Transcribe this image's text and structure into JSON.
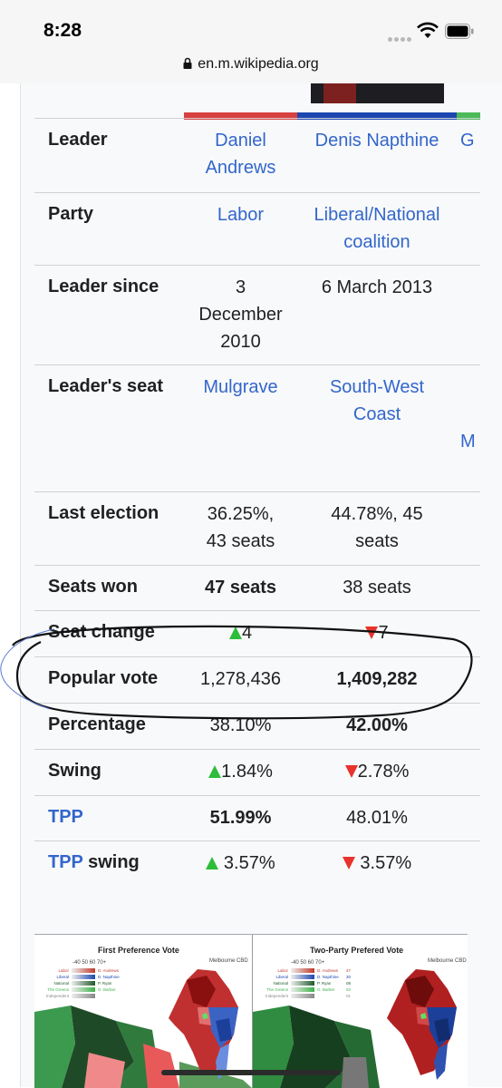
{
  "status": {
    "time": "8:28",
    "url": "en.m.wikipedia.org"
  },
  "colors": {
    "labor": "#d94040",
    "coalition": "#1c47b0",
    "greens": "#4cba59",
    "link": "#3366cc"
  },
  "rows": [
    {
      "label": "Leader",
      "label_link": false,
      "c1": [
        "Daniel",
        "Andrews"
      ],
      "c1_link": true,
      "c2": [
        "Denis Napthine"
      ],
      "c2_link": true,
      "c3": "G",
      "c3_link": true
    },
    {
      "label": "Party",
      "label_link": false,
      "c1": [
        "Labor"
      ],
      "c1_link": true,
      "c2": [
        "Liberal/National",
        "coalition"
      ],
      "c2_link": true
    },
    {
      "label": "Leader since",
      "label_link": false,
      "c1": [
        "3",
        "December",
        "2010"
      ],
      "c2": [
        "6 March 2013"
      ]
    },
    {
      "label": "Leader's seat",
      "label_link": false,
      "c1": [
        "Mulgrave"
      ],
      "c1_link": true,
      "c2": [
        "South-West",
        "Coast"
      ],
      "c2_link": true,
      "c3": "M",
      "c3_link": true
    },
    {
      "label": "Last election",
      "label_link": false,
      "c1": [
        "36.25%,",
        "43 seats"
      ],
      "c2": [
        "44.78%, 45",
        "seats"
      ]
    },
    {
      "label": "Seats won",
      "label_link": false,
      "c1": [
        "47 seats"
      ],
      "c1_bold": true,
      "c2": [
        "38 seats"
      ]
    },
    {
      "label": "Seat change",
      "label_link": false,
      "c1": [
        "4"
      ],
      "c1_arrow": "up",
      "c2": [
        "7"
      ],
      "c2_arrow": "down"
    },
    {
      "label": "Popular vote",
      "label_link": false,
      "c1": [
        "1,278,436"
      ],
      "c2": [
        "1,409,282"
      ],
      "c2_bold": true
    },
    {
      "label": "Percentage",
      "label_link": false,
      "c1": [
        "38.10%"
      ],
      "c2": [
        "42.00%"
      ],
      "c2_bold": true
    },
    {
      "label": "Swing",
      "label_link": false,
      "c1": [
        "1.84%"
      ],
      "c1_arrow": "up",
      "c2": [
        "2.78%"
      ],
      "c2_arrow": "down"
    },
    {
      "label": "TPP",
      "label_link": true,
      "c1": [
        "51.99%"
      ],
      "c1_bold": true,
      "c2": [
        "48.01%"
      ]
    },
    {
      "label": "TPP",
      "label_link": true,
      "label_suffix": " swing",
      "c1": [
        " 3.57%"
      ],
      "c1_arrow": "up",
      "c2": [
        " 3.57%"
      ],
      "c2_arrow": "down"
    }
  ],
  "maps": {
    "left_title": "First Preference Vote",
    "right_title": "Two-Party Prefered Vote",
    "left_city": "Melbourne CBD",
    "right_city": "Melbourne CBD",
    "legend_parties": [
      "Labor",
      "Liberal",
      "National",
      "The Greens",
      "Independent"
    ],
    "left_leaders": [
      "D. Andrews",
      "D. Napthine",
      "P. Ryan",
      "G. Barber"
    ],
    "right_leaders": [
      "D. Andrews",
      "D. Napthine",
      "P. Ryan",
      "G. Barber"
    ],
    "right_seats": [
      "47",
      "30",
      "08",
      "02",
      "01"
    ],
    "scale": "-40  50  60  70+"
  }
}
